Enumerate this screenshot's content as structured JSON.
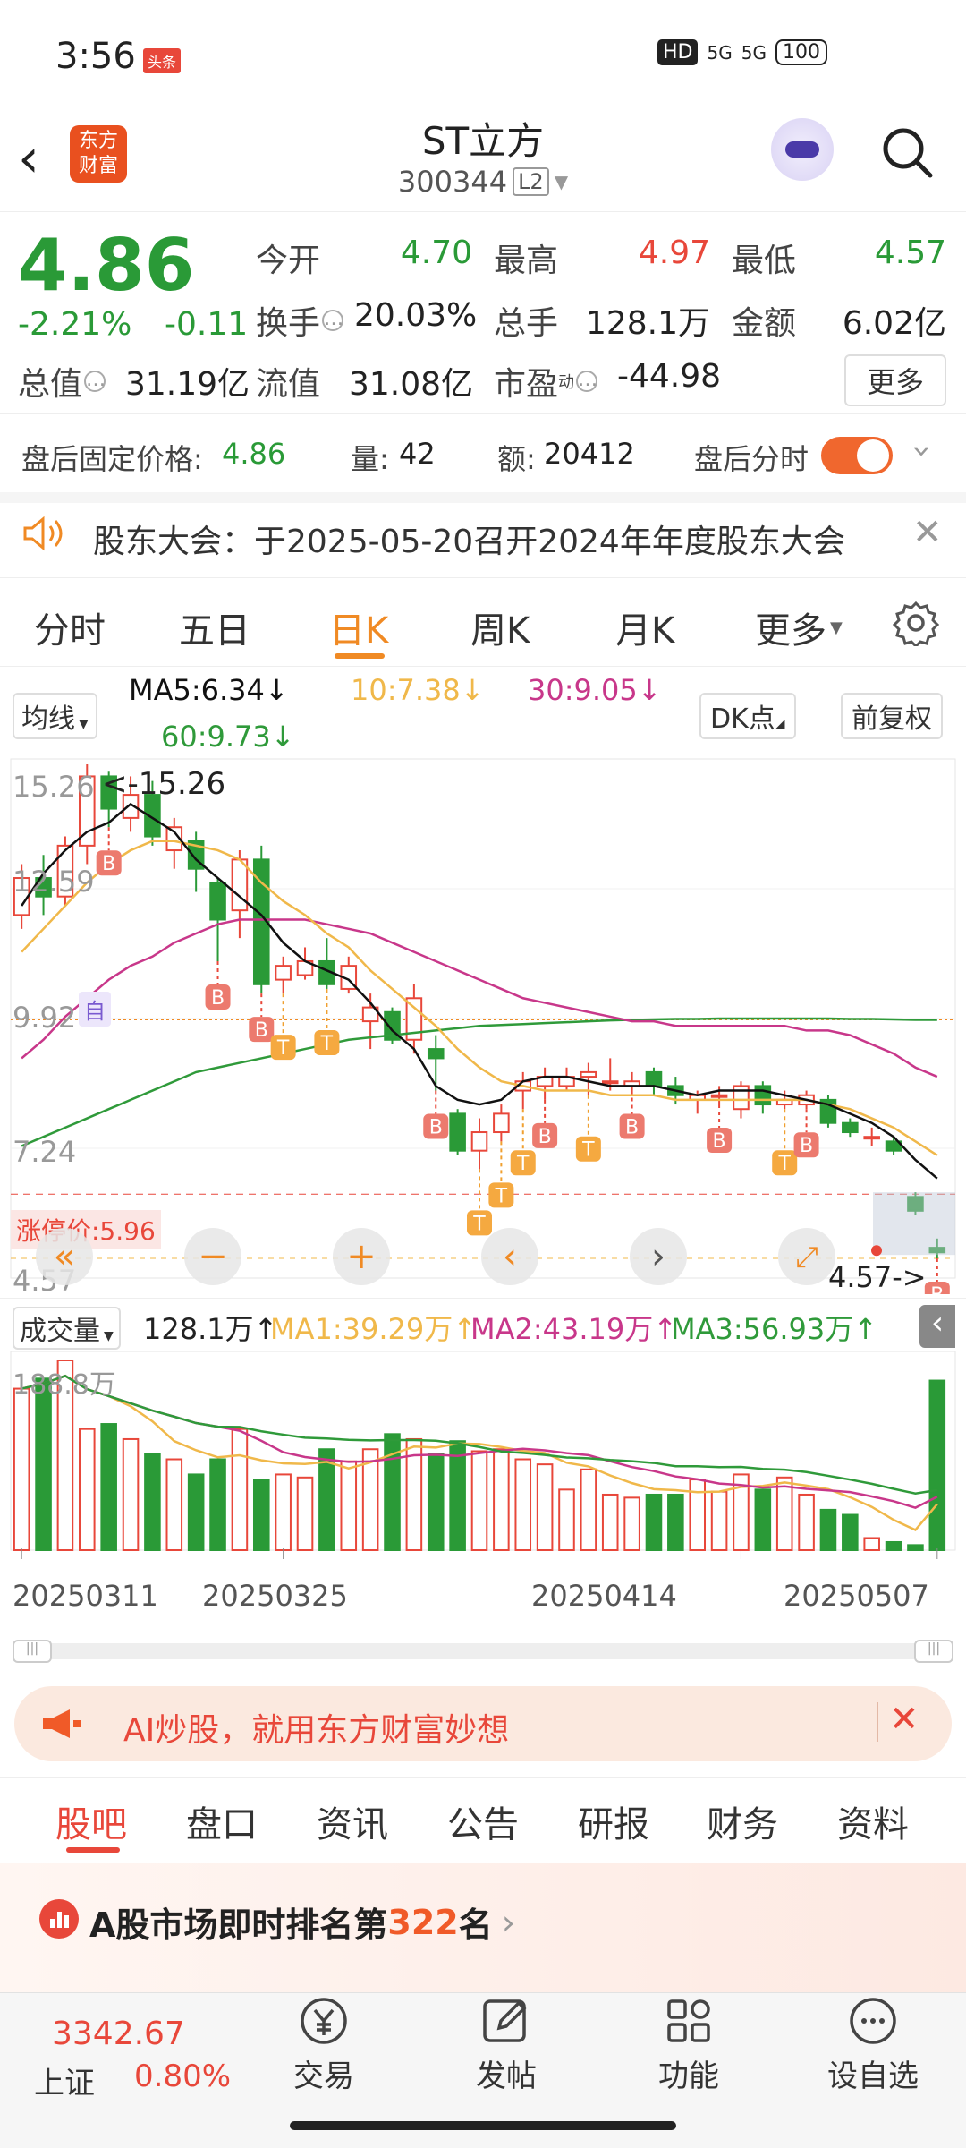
{
  "status_bar": {
    "time": "3:56",
    "news_badge": "头条",
    "hd": "HD",
    "sig1": "5G",
    "sig2": "5G",
    "battery": "100"
  },
  "header": {
    "logo_top": "东方",
    "logo_bottom": "财富",
    "name": "ST立方",
    "code": "300344",
    "level": "L2"
  },
  "quote": {
    "price": "4.86",
    "change_pct": "-2.21%",
    "change": "-0.11",
    "open_label": "今开",
    "open": "4.70",
    "high_label": "最高",
    "high": "4.97",
    "low_label": "最低",
    "low": "4.57",
    "turnover_label": "换手",
    "turnover": "20.03%",
    "volume_label": "总手",
    "volume": "128.1万",
    "amount_label": "金额",
    "amount": "6.02亿",
    "mktcap_label": "总值",
    "mktcap": "31.19亿",
    "float_label": "流值",
    "float": "31.08亿",
    "pe_label": "市盈",
    "pe_sup": "动",
    "pe": "-44.98",
    "more": "更多"
  },
  "afterhours": {
    "price_label": "盘后固定价格:",
    "price": "4.86",
    "vol_label": "量:",
    "vol": "42",
    "amt_label": "额:",
    "amt": "20412",
    "toggle_label": "盘后分时"
  },
  "notice": {
    "text": "股东大会：于2025-05-20召开2024年年度股东大会"
  },
  "chart_tabs": [
    "分时",
    "五日",
    "日K",
    "周K",
    "月K",
    "更多"
  ],
  "ma": {
    "select": "均线",
    "ma5": "MA5:6.34↓",
    "ma10": "10:7.38↓",
    "ma30": "30:9.05↓",
    "ma60": "60:9.73↓",
    "dk": "DK点",
    "fq": "前复权"
  },
  "kchart": {
    "y_labels": [
      "15.26",
      "12.59",
      "9.92",
      "7.24",
      "4.57"
    ],
    "max_marker": "<-15.26",
    "min_marker": "4.57->",
    "limit_up": "涨停价:5.96",
    "self_badge": "自"
  },
  "volbar": {
    "select": "成交量",
    "total": "128.1万↑",
    "ma1": "MA1:39.29万↑",
    "ma2": "MA2:43.19万↑",
    "ma3": "MA3:56.93万↑",
    "ylabel": "188.8万"
  },
  "dates": [
    "20250311",
    "20250325",
    "20250414",
    "20250507"
  ],
  "ad": {
    "text": "AI炒股，就用东方财富妙想"
  },
  "bottom_tabs": [
    "股吧",
    "盘口",
    "资讯",
    "公告",
    "研报",
    "财务",
    "资料"
  ],
  "rank": {
    "prefix": "A股市场即时排名第",
    "num": "322",
    "suffix": "名"
  },
  "nav": {
    "index_value": "3342.67",
    "index_name": "上证",
    "index_pct": "0.80%",
    "trade": "交易",
    "post": "发帖",
    "func": "功能",
    "watch": "设自选"
  },
  "colors": {
    "up": "#e8473a",
    "down": "#2a9a37",
    "accent": "#f08a24",
    "ma5": "#111111",
    "ma10": "#f0b84a",
    "ma30": "#c8378a",
    "ma60": "#2f9a3a"
  },
  "chart_data": {
    "type": "candlestick",
    "y_range": [
      4.57,
      15.26
    ],
    "candles": [
      [
        12.0,
        12.8,
        13.1,
        11.7
      ],
      [
        12.8,
        12.4,
        13.3,
        12.0
      ],
      [
        12.4,
        13.5,
        13.7,
        12.2
      ],
      [
        13.5,
        15.0,
        15.26,
        13.1
      ],
      [
        15.0,
        14.3,
        15.1,
        13.9
      ],
      [
        14.1,
        14.6,
        15.0,
        13.8
      ],
      [
        14.6,
        13.7,
        14.9,
        13.5
      ],
      [
        13.4,
        13.9,
        14.1,
        13.0
      ],
      [
        13.6,
        13.0,
        13.8,
        12.5
      ],
      [
        12.7,
        11.9,
        12.8,
        11.0
      ],
      [
        12.1,
        13.2,
        13.4,
        11.5
      ],
      [
        13.2,
        10.5,
        13.5,
        10.3
      ],
      [
        10.6,
        10.9,
        11.1,
        10.3
      ],
      [
        10.7,
        11.0,
        11.3,
        10.6
      ],
      [
        11.0,
        10.5,
        11.5,
        10.4
      ],
      [
        10.4,
        10.9,
        11.1,
        10.3
      ],
      [
        9.7,
        10.0,
        10.3,
        9.1
      ],
      [
        9.9,
        9.3,
        10.0,
        9.2
      ],
      [
        9.3,
        10.2,
        10.5,
        9.0
      ],
      [
        9.1,
        8.9,
        9.4,
        8.2
      ],
      [
        7.7,
        6.9,
        7.8,
        6.8
      ],
      [
        6.9,
        7.3,
        7.6,
        6.5
      ],
      [
        7.3,
        7.7,
        7.9,
        7.1
      ],
      [
        8.2,
        8.4,
        8.6,
        7.8
      ],
      [
        8.3,
        8.5,
        8.7,
        8.0
      ],
      [
        8.3,
        8.5,
        8.7,
        8.2
      ],
      [
        8.5,
        8.6,
        8.8,
        8.1
      ],
      [
        8.4,
        8.4,
        8.9,
        8.2
      ],
      [
        8.3,
        8.4,
        8.6,
        8.2
      ],
      [
        8.6,
        8.3,
        8.7,
        8.1
      ],
      [
        8.3,
        8.1,
        8.5,
        7.9
      ],
      [
        8.0,
        8.1,
        8.2,
        7.7
      ],
      [
        8.1,
        8.1,
        8.3,
        7.9
      ],
      [
        7.8,
        8.3,
        8.4,
        7.6
      ],
      [
        8.3,
        7.9,
        8.4,
        7.7
      ],
      [
        7.9,
        8.0,
        8.2,
        7.8
      ],
      [
        7.9,
        8.1,
        8.2,
        7.8
      ],
      [
        8.0,
        7.5,
        8.1,
        7.4
      ],
      [
        7.5,
        7.3,
        7.6,
        7.2
      ],
      [
        7.2,
        7.2,
        7.4,
        7.0
      ],
      [
        7.1,
        6.9,
        7.2,
        6.8
      ],
      [
        5.9,
        5.6,
        6.0,
        5.5
      ],
      [
        4.8,
        4.7,
        5.0,
        4.57
      ]
    ],
    "volumes": [
      160,
      170,
      188,
      120,
      125,
      110,
      95,
      90,
      75,
      90,
      120,
      70,
      75,
      72,
      100,
      88,
      100,
      115,
      110,
      95,
      108,
      98,
      100,
      90,
      85,
      60,
      80,
      55,
      52,
      55,
      55,
      70,
      58,
      75,
      60,
      72,
      55,
      40,
      35,
      12,
      8,
      5,
      168
    ],
    "ma5": [
      12.2,
      12.9,
      13.4,
      13.8,
      14.0,
      14.4,
      14.1,
      13.8,
      13.2,
      12.8,
      12.4,
      12.0,
      11.4,
      11.0,
      10.8,
      10.6,
      10.1,
      9.5,
      9.1,
      8.3,
      8.0,
      7.9,
      8.0,
      8.4,
      8.5,
      8.5,
      8.4,
      8.3,
      8.3,
      8.3,
      8.2,
      8.1,
      8.2,
      8.2,
      8.2,
      8.1,
      8.0,
      7.9,
      7.7,
      7.5,
      7.2,
      6.7,
      6.3
    ],
    "ma10": [
      11.2,
      11.7,
      12.2,
      12.7,
      13.1,
      13.4,
      13.6,
      13.6,
      13.5,
      13.4,
      13.2,
      12.7,
      12.3,
      12.0,
      11.6,
      11.3,
      10.8,
      10.4,
      10.0,
      9.6,
      9.1,
      8.7,
      8.4,
      8.3,
      8.2,
      8.2,
      8.2,
      8.1,
      8.1,
      8.1,
      8.0,
      8.0,
      8.0,
      8.0,
      8.0,
      8.0,
      8.0,
      7.9,
      7.8,
      7.6,
      7.4,
      7.1,
      6.8
    ],
    "ma30": [
      8.9,
      9.3,
      9.8,
      10.2,
      10.6,
      10.9,
      11.1,
      11.4,
      11.6,
      11.8,
      11.9,
      11.9,
      11.9,
      11.9,
      11.8,
      11.7,
      11.6,
      11.4,
      11.2,
      11.0,
      10.8,
      10.6,
      10.4,
      10.2,
      10.1,
      10.0,
      9.9,
      9.8,
      9.7,
      9.7,
      9.6,
      9.6,
      9.6,
      9.6,
      9.6,
      9.6,
      9.5,
      9.5,
      9.4,
      9.2,
      9.0,
      8.7,
      8.5
    ],
    "ma60": [
      7.0,
      7.2,
      7.4,
      7.6,
      7.8,
      8.0,
      8.2,
      8.4,
      8.6,
      8.7,
      8.8,
      8.9,
      9.0,
      9.1,
      9.2,
      9.3,
      9.35,
      9.4,
      9.45,
      9.5,
      9.55,
      9.6,
      9.62,
      9.64,
      9.66,
      9.68,
      9.7,
      9.72,
      9.73,
      9.74,
      9.75,
      9.75,
      9.76,
      9.76,
      9.76,
      9.76,
      9.76,
      9.76,
      9.75,
      9.75,
      9.74,
      9.73,
      9.73
    ]
  }
}
